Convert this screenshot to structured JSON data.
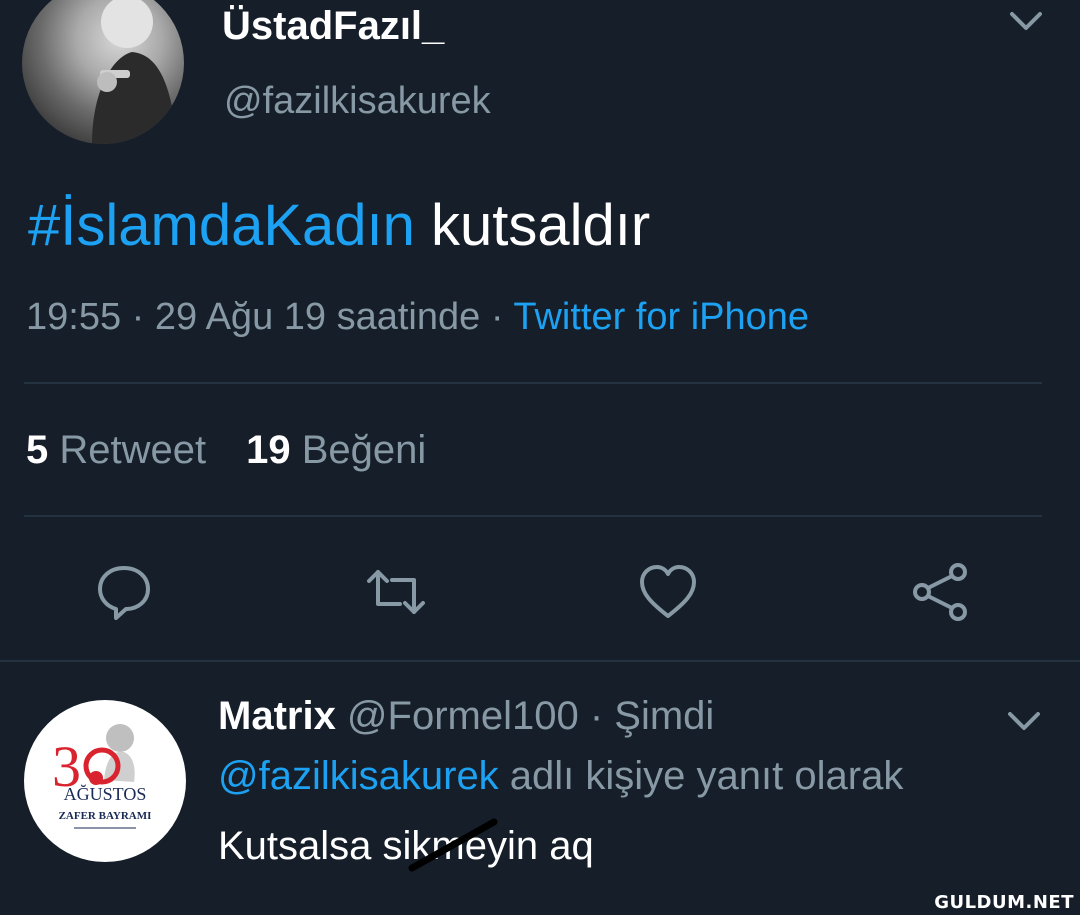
{
  "tweet": {
    "display_name": "ÜstadFazıl_",
    "handle": "@fazilkisakurek",
    "hashtag": "#İslamdaKadın",
    "text": " kutsaldır",
    "time": "19:55 · 29 Ağu 19 saatinde · ",
    "source": "Twitter for iPhone",
    "retweets_count": "5",
    "retweets_label": "Retweet",
    "likes_count": "19",
    "likes_label": "Beğeni"
  },
  "actions": {
    "reply_icon": "reply-icon",
    "retweet_icon": "retweet-icon",
    "like_icon": "heart-icon",
    "share_icon": "share-icon"
  },
  "reply": {
    "display_name": "Matrix",
    "handle_time": " @Formel100 · Şimdi",
    "mention": "@fazilkisakurek",
    "reply_context": " adlı kişiye yanıt olarak",
    "text": "Kutsalsa sikmeyin aq",
    "avatar": {
      "line1": "AĞUSTOS",
      "line2": "ZAFER BAYRAMI",
      "number": "30"
    }
  },
  "watermark": "GULDUM.NET",
  "colors": {
    "background": "#151e29",
    "accent": "#1da1f2",
    "muted": "#8899a6",
    "divider": "#253341"
  }
}
